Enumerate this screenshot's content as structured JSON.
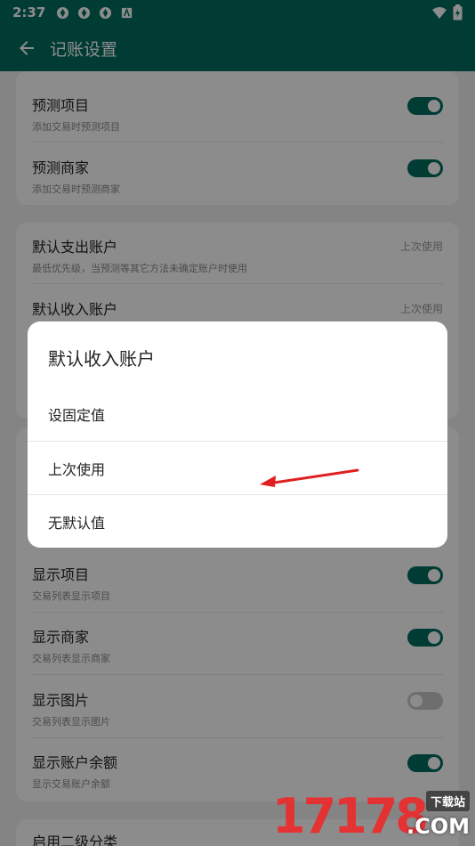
{
  "status": {
    "time": "2:37"
  },
  "appbar": {
    "title": "记账设置"
  },
  "card1": {
    "items": [
      {
        "title": "预测项目",
        "subtitle": "添加交易时预测项目",
        "on": true
      },
      {
        "title": "预测商家",
        "subtitle": "添加交易时预测商家",
        "on": true
      }
    ]
  },
  "card2": {
    "items": [
      {
        "title": "默认支出账户",
        "subtitle": "最低优先级，当预测等其它方法未确定账户时使用",
        "value": "上次使用"
      },
      {
        "title": "默认收入账户",
        "value": "上次使用"
      }
    ]
  },
  "card3": {
    "items": [
      {
        "title": "显示项目",
        "subtitle": "交易列表显示项目",
        "on": true
      },
      {
        "title": "显示商家",
        "subtitle": "交易列表显示商家",
        "on": true
      },
      {
        "title": "显示图片",
        "subtitle": "交易列表显示图片",
        "on": false
      },
      {
        "title": "显示账户余额",
        "subtitle": "显示交易账户余额",
        "on": true
      }
    ]
  },
  "card4": {
    "items": [
      {
        "title": "启用二级分类"
      }
    ]
  },
  "dialog": {
    "title": "默认收入账户",
    "options": [
      "设固定值",
      "上次使用",
      "无默认值"
    ]
  },
  "watermark": {
    "number": "17178",
    "badge": "下载站",
    "domain": ".COM"
  },
  "colors": {
    "primary": "#006d5f",
    "arrow": "#e02020"
  }
}
